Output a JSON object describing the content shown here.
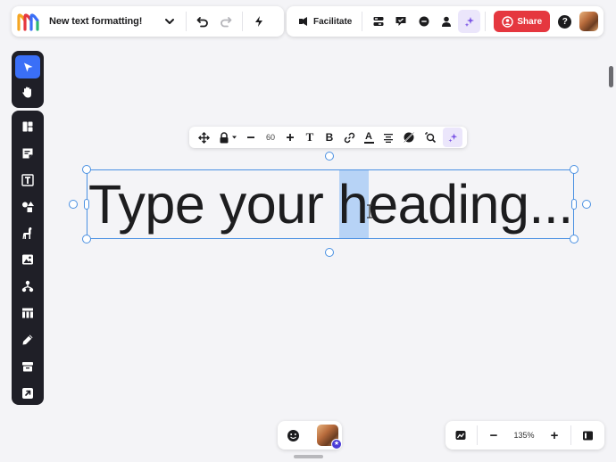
{
  "header": {
    "board_title": "New text formatting!",
    "facilitate_label": "Facilitate",
    "share_label": "Share",
    "help_label": "?"
  },
  "text_toolbar": {
    "font_size": "60",
    "text_type_glyph": "T",
    "bold_glyph": "B",
    "text_color_glyph": "A"
  },
  "canvas": {
    "heading_text": "Type your heading..."
  },
  "zoom": {
    "level": "135%",
    "minus_label": "−",
    "plus_label": "+"
  },
  "colors": {
    "accent": "#3a6ff7",
    "share": "#e5373f",
    "selection": "#4a90e2",
    "ai": "#7b55e6"
  },
  "icons": {
    "left_tools": [
      "select-icon",
      "hand-icon",
      "templates-icon",
      "sticky-note-icon",
      "text-icon",
      "shapes-icon",
      "animal-icon",
      "image-icon",
      "diagram-icon",
      "table-icon",
      "pen-icon",
      "frame-icon",
      "upload-icon"
    ]
  }
}
